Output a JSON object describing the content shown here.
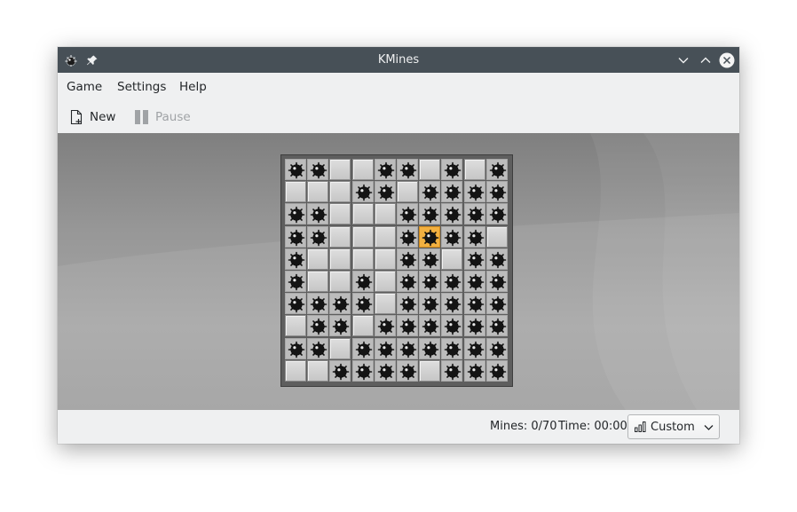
{
  "window": {
    "title": "KMines"
  },
  "menu": {
    "items": [
      "Game",
      "Settings",
      "Help"
    ]
  },
  "toolbar": {
    "new_label": "New",
    "pause_label": "Pause"
  },
  "board": {
    "rows": 10,
    "cols": 10,
    "cells": [
      "MMCCMMCMCM",
      "CCCMMCMMMM",
      "MMCCCMMMMM",
      "MMCCCMXMMC",
      "MCCCCMMCMM",
      "MCCMCMMMMM",
      "MMMMCMMMMM",
      "CMMCMMMMMM",
      "MMCMMMMMMM",
      "CCMMMMCMMM"
    ],
    "legend": {
      "M": "mine-revealed",
      "C": "covered",
      "X": "exploded-mine"
    }
  },
  "status": {
    "mines": "Mines: 0/70",
    "time": "Time: 00:00",
    "difficulty": "Custom"
  },
  "colors": {
    "titlebar": "#475057",
    "window_bg": "#eff0f1",
    "exploded": "#f2b040"
  }
}
